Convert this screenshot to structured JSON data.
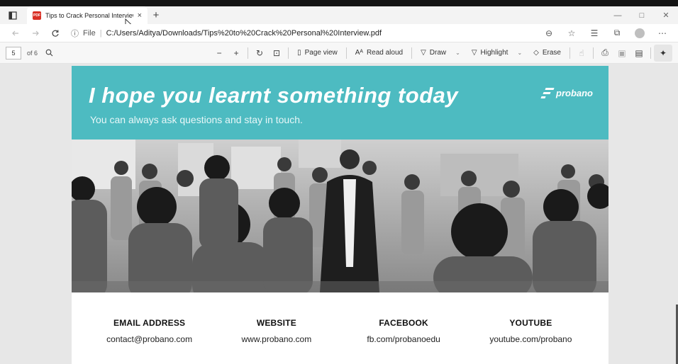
{
  "tab": {
    "title": "Tips to Crack Personal Interview",
    "close": "×",
    "new_tab": "+"
  },
  "window": {
    "minimize": "—",
    "restore": "□",
    "close": "✕"
  },
  "address": {
    "scheme": "File",
    "url": "C:/Users/Aditya/Downloads/Tips%20to%20Crack%20Personal%20Interview.pdf"
  },
  "pdf_toolbar": {
    "page_number": "5",
    "page_of": "of 6",
    "page_view": "Page view",
    "read_aloud": "Read aloud",
    "draw": "Draw",
    "highlight": "Highlight",
    "erase": "Erase"
  },
  "document": {
    "headline": "I hope you learnt something today",
    "subline": "You can always ask questions and stay in touch.",
    "logo_text": "probano",
    "banner_color": "#4dbbc1",
    "contacts": [
      {
        "label": "EMAIL ADDRESS",
        "value": "contact@probano.com"
      },
      {
        "label": "WEBSITE",
        "value": "www.probano.com"
      },
      {
        "label": "FACEBOOK",
        "value": "fb.com/probanoedu"
      },
      {
        "label": "YOUTUBE",
        "value": "youtube.com/probano"
      }
    ]
  }
}
